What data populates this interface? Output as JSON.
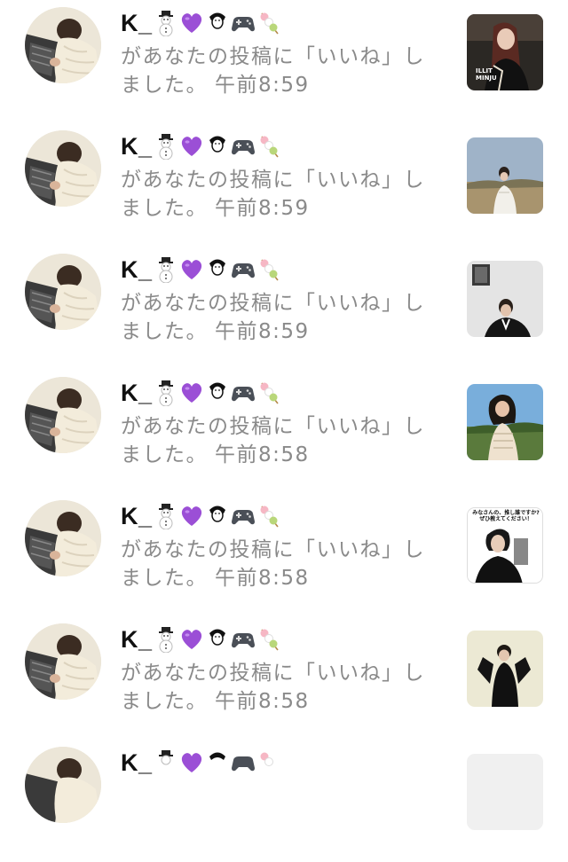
{
  "notifications": [
    {
      "username": "K_",
      "message": "があなたの投稿に「いいね」しました。",
      "time": "午前8:59",
      "thumb_caption": "ILLIT MINJU",
      "thumb_bg": "#2b2824"
    },
    {
      "username": "K_",
      "message": "があなたの投稿に「いいね」しました。",
      "time": "午前8:59",
      "thumb_caption": "",
      "thumb_bg": "#8aa0b8"
    },
    {
      "username": "K_",
      "message": "があなたの投稿に「いいね」しました。",
      "time": "午前8:59",
      "thumb_caption": "",
      "thumb_bg": "#dcdcdc"
    },
    {
      "username": "K_",
      "message": "があなたの投稿に「いいね」しました。",
      "time": "午前8:58",
      "thumb_caption": "",
      "thumb_bg": "#6fa3d0"
    },
    {
      "username": "K_",
      "message": "があなたの投稿に「いいね」しました。",
      "time": "午前8:58",
      "thumb_caption": "みなさんの、推し誰ですか? ぜひ教えてください！",
      "thumb_bg": "#ffffff"
    },
    {
      "username": "K_",
      "message": "があなたの投稿に「いいね」しました。",
      "time": "午前8:58",
      "thumb_caption": "",
      "thumb_bg": "#e8e6d2"
    },
    {
      "username": "K_",
      "message": "",
      "time": "",
      "thumb_caption": "",
      "thumb_bg": "#f2f2f2"
    }
  ],
  "name_emojis": [
    "snowman-icon",
    "purple-heart-icon",
    "penguin-icon",
    "game-controller-icon",
    "dango-icon"
  ],
  "colors": {
    "username": "#111111",
    "message": "#8a8a8a",
    "background": "#ffffff",
    "heart": "#9b4fd6"
  }
}
